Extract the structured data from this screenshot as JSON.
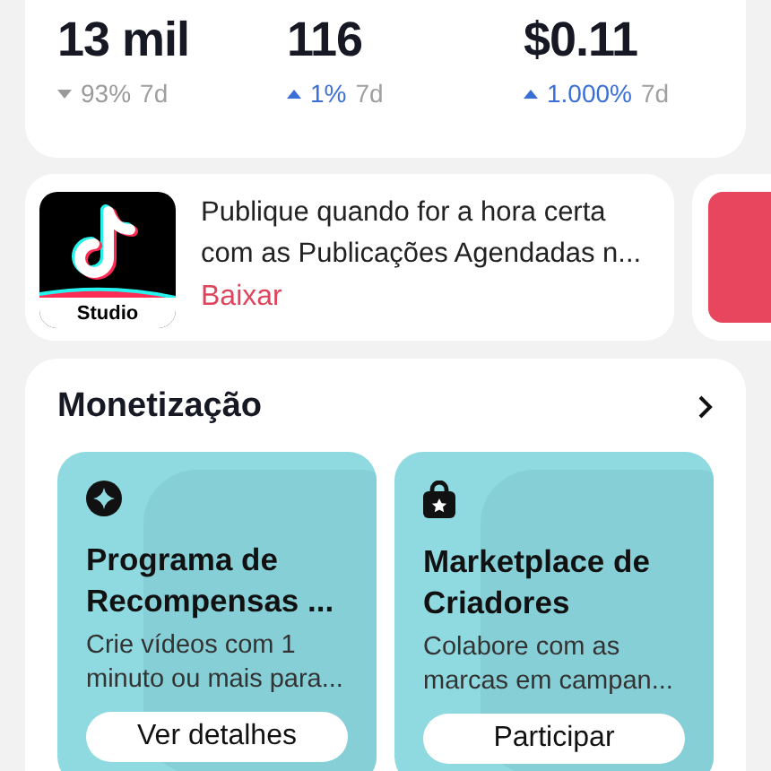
{
  "stats": [
    {
      "value": "13 mil",
      "kind": "down",
      "change": "93%",
      "period": "7d"
    },
    {
      "value": "116",
      "kind": "up",
      "change": "1%",
      "period": "7d"
    },
    {
      "value": "$0.11",
      "kind": "up",
      "change": "1.000%",
      "period": "7d"
    }
  ],
  "promo": {
    "app_label": "Studio",
    "text": "Publique quando for a hora certa com as Publicações Agendadas n...",
    "action": "Baixar"
  },
  "monetization": {
    "title": "Monetização",
    "cards": [
      {
        "title": "Programa de Recompensas ...",
        "description": "Crie vídeos com 1 minuto ou mais para...",
        "button": "Ver detalhes"
      },
      {
        "title": "Marketplace de Criadores",
        "description": "Colabore com as marcas em campan...",
        "button": "Participar"
      }
    ]
  }
}
